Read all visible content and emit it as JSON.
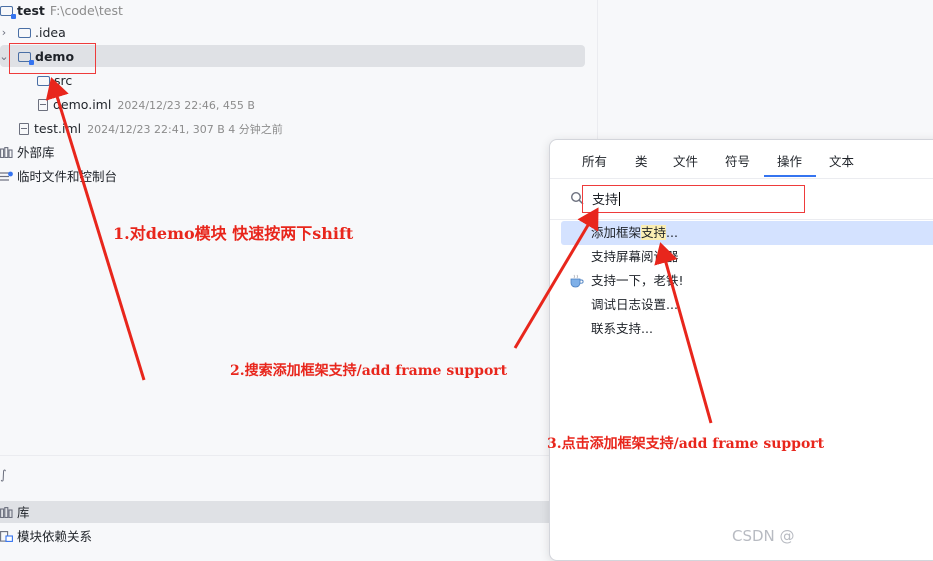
{
  "project_tree": {
    "root": {
      "name": "test",
      "path": "F:\\code\\test"
    },
    "idea": {
      "name": ".idea"
    },
    "demo": {
      "name": "demo"
    },
    "src": {
      "name": "src"
    },
    "demo_iml": {
      "name": "demo.iml",
      "meta": "2024/12/23 22:46, 455 B"
    },
    "test_iml": {
      "name": "test.iml",
      "meta": "2024/12/23 22:41, 307 B 4 分钟之前"
    },
    "external_libs": {
      "label": "外部库"
    },
    "scratches": {
      "label": "临时文件和控制台"
    }
  },
  "bottom_panel": {
    "stub": "∫",
    "libraries": "库",
    "module_deps": "模块依赖关系"
  },
  "search_popup": {
    "tabs": [
      "所有",
      "类",
      "文件",
      "符号",
      "操作",
      "文本"
    ],
    "active_tab": "操作",
    "query": "支持",
    "results": [
      {
        "before": "添加框架",
        "match": "支持",
        "after": "..."
      },
      {
        "before": "",
        "match": "支持",
        "after": "屏幕阅读器"
      },
      {
        "before": "",
        "match": "支持",
        "after": "一下，老铁!"
      },
      {
        "before": "调试日志设置...",
        "match": "",
        "after": ""
      },
      {
        "before": "联系",
        "match": "支持",
        "after": "..."
      }
    ]
  },
  "annotations": {
    "step1": "1.对demo模块 快速按两下shift",
    "step2": "2.搜索添加框架支持/add frame support",
    "step3": "3.点击添加框架支持/add frame support"
  },
  "watermark": "CSDN @",
  "colors": {
    "annotation_red": "#e8261c",
    "accent_blue": "#3574f0",
    "selection": "#d4e2ff",
    "highlight": "#fbeeb2"
  }
}
